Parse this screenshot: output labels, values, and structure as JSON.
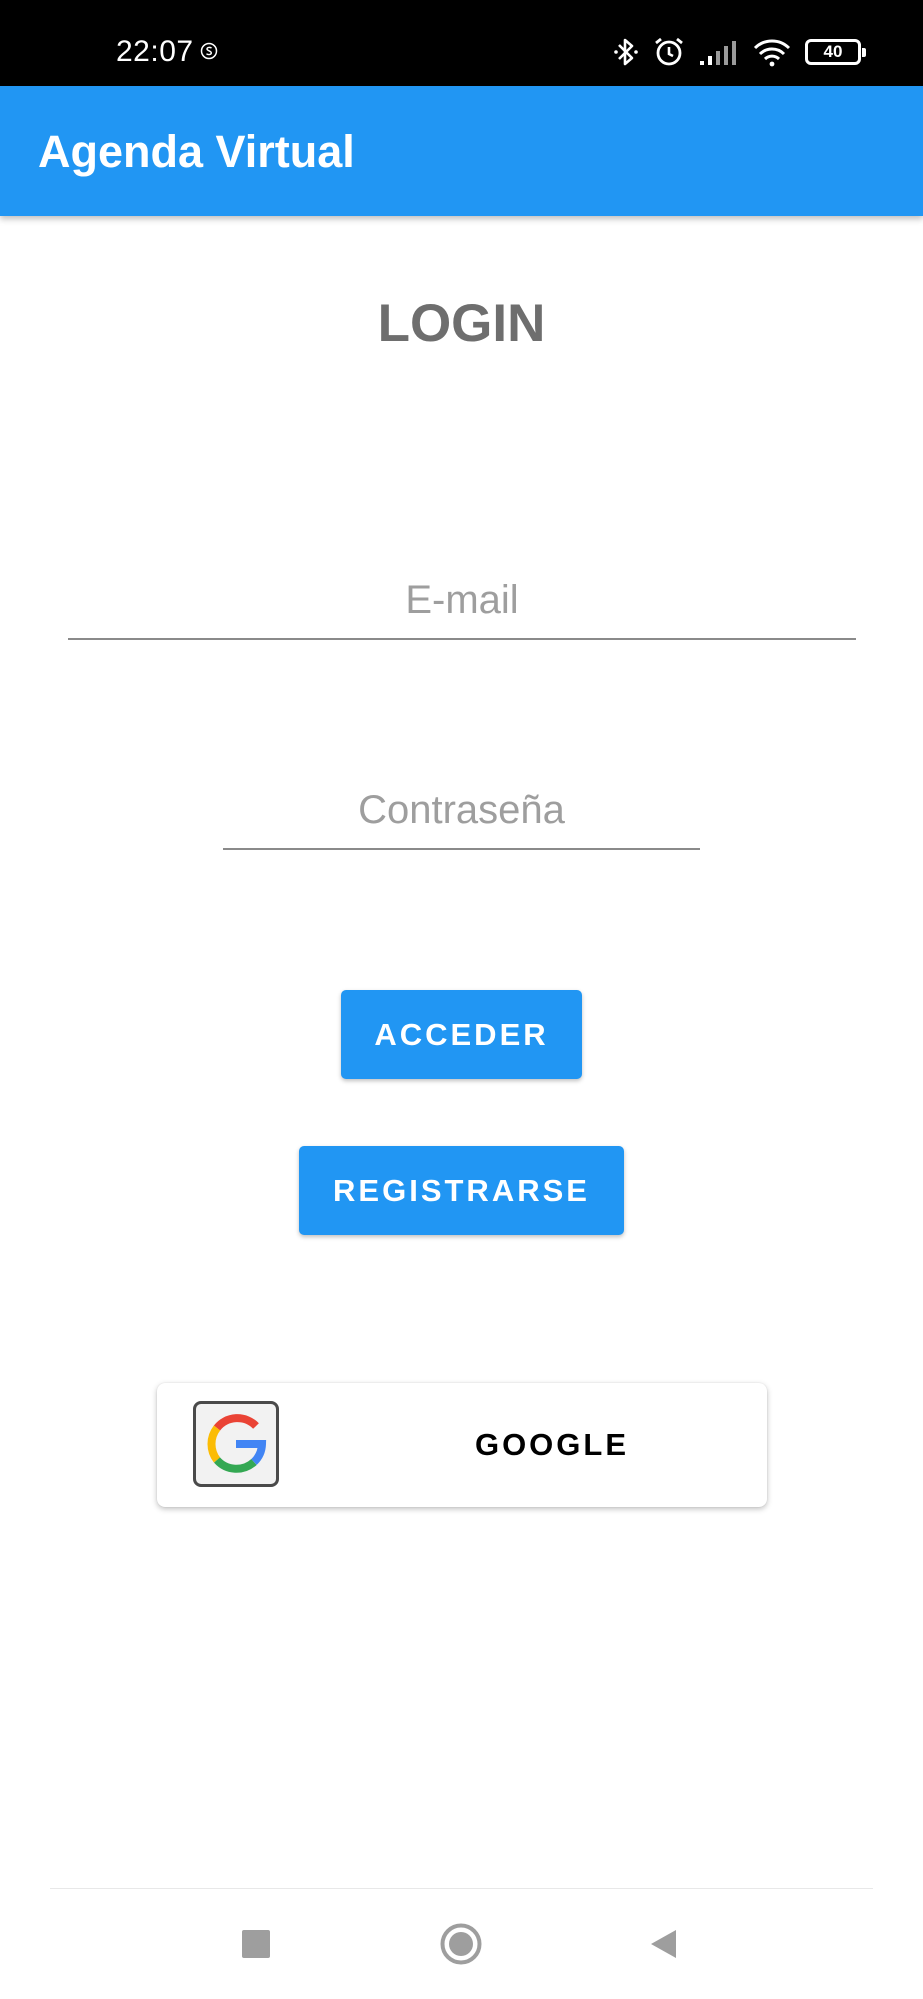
{
  "status_bar": {
    "time": "22:07",
    "battery": "40",
    "icons": [
      "s-icon",
      "bluetooth-icon",
      "alarm-icon",
      "signal-icon",
      "wifi-icon",
      "battery-icon"
    ]
  },
  "app_bar": {
    "title": "Agenda Virtual",
    "color": "#2196F3"
  },
  "login": {
    "title": "LOGIN",
    "email_placeholder": "E-mail",
    "email_value": "",
    "password_placeholder": "Contraseña",
    "password_value": "",
    "access_label": "ACCEDER",
    "register_label": "REGISTRARSE",
    "google_label": "GOOGLE"
  },
  "nav_bar": {
    "icons": [
      "recents-square-icon",
      "home-circle-icon",
      "back-triangle-icon"
    ]
  }
}
